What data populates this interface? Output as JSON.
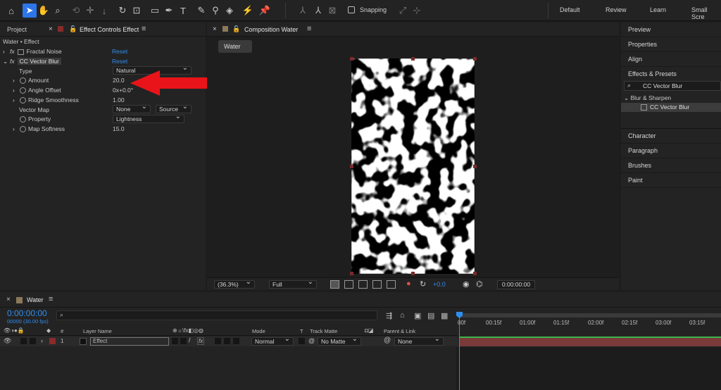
{
  "toolbar": {
    "snapping_label": "Snapping",
    "workspaces": [
      "Default",
      "Review",
      "Learn",
      "Small Scre"
    ]
  },
  "effect_controls": {
    "project_tab": "Project",
    "tab_title": "Effect Controls Effect",
    "breadcrumb": "Water • Effect",
    "effects": [
      {
        "name": "Fractal Noise",
        "reset": "Reset"
      },
      {
        "name": "CC Vector Blur",
        "reset": "Reset"
      }
    ],
    "props": {
      "type_label": "Type",
      "type_value": "Natural",
      "amount_label": "Amount",
      "amount_value": "20.0",
      "angle_label": "Angle Offset",
      "angle_value": "0x+0.0°",
      "ridge_label": "Ridge Smoothness",
      "ridge_value": "1.00",
      "vectormap_label": "Vector Map",
      "vectormap_value": "None",
      "vectormap_source": "Source",
      "property_label": "Property",
      "property_value": "Lightness",
      "mapsoft_label": "Map Softness",
      "mapsoft_value": "15.0"
    }
  },
  "composition": {
    "tab_title": "Composition Water",
    "chip": "Water",
    "zoom": "(36.3%)",
    "resolution": "Full",
    "exposure": "+0.0",
    "timecode": "0:00:00:00"
  },
  "right_panel": {
    "top_items": [
      "Preview",
      "Properties",
      "Align",
      "Effects & Presets"
    ],
    "search_value": "CC Vector Blur",
    "category": "Blur & Sharpen",
    "result": "CC Vector Blur",
    "bottom_items": [
      "Character",
      "Paragraph",
      "Brushes",
      "Paint"
    ]
  },
  "timeline": {
    "comp_tab": "Water",
    "timecode": "0:00:00:00",
    "fps": "00000 (30.00 fps)",
    "headers": {
      "num": "#",
      "layer_name": "Layer Name",
      "mode": "Mode",
      "t": "T",
      "track_matte": "Track Matte",
      "parent": "Parent & Link"
    },
    "layer": {
      "index": "1",
      "name": "Effect",
      "mode": "Normal",
      "matte": "No Matte",
      "parent": "None"
    },
    "ruler": [
      "00f",
      "00:15f",
      "01:00f",
      "01:15f",
      "02:00f",
      "02:15f",
      "03:00f",
      "03:15f"
    ]
  },
  "colors": {
    "accent": "#2e8ef0",
    "annotation_arrow": "#e8141a",
    "layer_bar": "#7a3a3a"
  }
}
